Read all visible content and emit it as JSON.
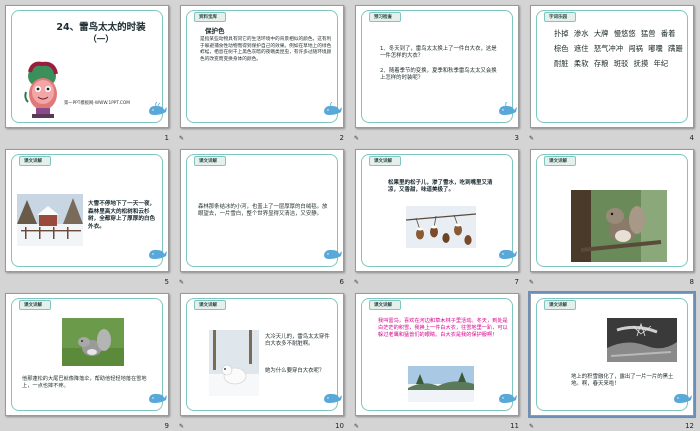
{
  "slides": [
    {
      "num": "1",
      "title": "24、雷鸟太太的时装",
      "subtitle": "（一）",
      "footer": "第一PPT模板网-WWW.1PPT.COM"
    },
    {
      "num": "2",
      "tag": "资料宝库",
      "heading": "保护色",
      "body": "是指某些动物具有同它的生活环境中的背景相似的颜色，这有利于躲避捕食性动物而得到保护自己的效果。例如在草地上的绿色蚱蜢，栖息在树干上黑色灰暗的夜蛾类昆虫，有许多过随环境颜色的改变而变换身体的颜色。"
    },
    {
      "num": "3",
      "tag": "预习检查",
      "q1": "1、冬天到了，雷鸟太太换上了一件白大衣，这是一件怎样的大衣？",
      "q2": "2、随着季节的变换，夏季和秋季雷鸟太太又会换上怎样的时装呢？"
    },
    {
      "num": "4",
      "tag": "字词乐园",
      "words": "扑掉 渗水 大牌 慢悠悠 猛兽 番着 棕色 遮住 怒气冲冲 闯祸 嘟囔 蹒跚 耐脏 柔软 存粮 斑驳 抚摸 年纪"
    },
    {
      "num": "5",
      "tag": "课文详解",
      "body": "大雪不停地下了一天一夜，森林里高大的松树和云杉树，全都穿上了厚厚的白色外衣。"
    },
    {
      "num": "6",
      "tag": "课文详解",
      "body": "森林那条结冰的小河，也盖上了一层厚厚的白绒毯。放眼望去，一片雪白，整个世界显得又清洁，又安静。"
    },
    {
      "num": "7",
      "tag": "课文详解",
      "body": "松果里的松子儿，渗了雪水，吃到嘴里又清凉，又香甜，味道美极了。"
    },
    {
      "num": "8",
      "tag": "课文详解"
    },
    {
      "num": "9",
      "tag": "课文详解",
      "body": "他那蓬松的大尾巴就像降落伞，帮助他轻轻地落在雪地上，一点也摔不疼。"
    },
    {
      "num": "10",
      "tag": "课文详解",
      "body": "大冷天儿的，雷鸟太太穿件白大衣多不耐脏啊。",
      "body2": "她为什么要穿白大衣呢？"
    },
    {
      "num": "11",
      "tag": "课文详解",
      "body": "我叫雷鸟，喜欢在河边和草木林子里活动。冬天，到处是白茫茫的积雪，我换上一件白大衣，往雪地里一趴，可以躲过老鹰和猛兽们的眼睛。白大衣是我的保护服啊！"
    },
    {
      "num": "12",
      "tag": "课文详解",
      "body": "地上的积雪融化了，露出了一片一片的黑土地。啊，春天来啦！"
    }
  ],
  "colors": {
    "border": "#7fc6c0",
    "accent_red": "#cc0000",
    "magenta": "#d4008a",
    "whale": "#58a8d8"
  },
  "notes_icon": "notes-icon"
}
